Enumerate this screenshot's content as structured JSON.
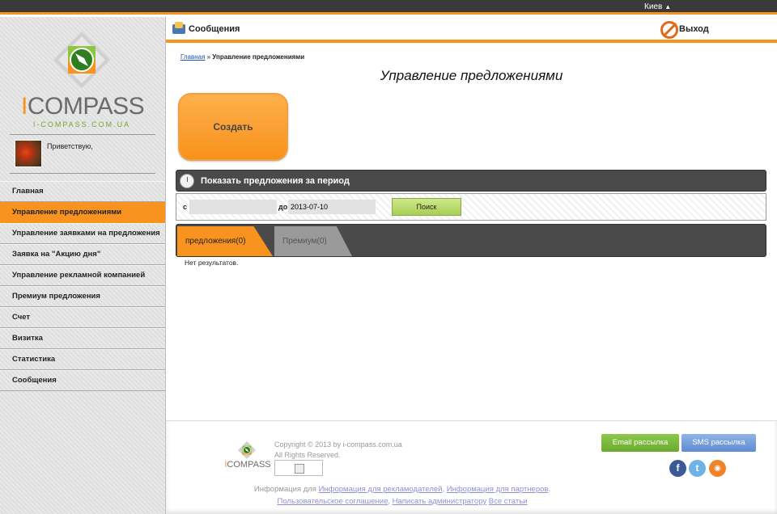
{
  "topbar": {
    "city": "Киев"
  },
  "sidebar": {
    "logo": {
      "prefix": "I",
      "word": "COMPASS",
      "url": "I-COMPASS.COM.UA"
    },
    "greeting": "Приветствую,",
    "items": [
      {
        "label": "Главная"
      },
      {
        "label": "Управление предложениями",
        "active": true
      },
      {
        "label": "Управление заявками на предложения"
      },
      {
        "label": "Заявка на \"Акцию дня\""
      },
      {
        "label": "Управление рекламной компанией"
      },
      {
        "label": "Премиум предложения"
      },
      {
        "label": "Счет"
      },
      {
        "label": "Визитка"
      },
      {
        "label": "Статистика"
      },
      {
        "label": "Сообщения"
      }
    ]
  },
  "header": {
    "messages": "Сообщения",
    "exit": "Выход"
  },
  "breadcrumb": {
    "home": "Главная",
    "sep": " » ",
    "current": "Управление предложениями"
  },
  "page_title": "Управление предложениями",
  "create_button": "Создать",
  "period_panel": {
    "title": "Показать предложения за период",
    "from_label": "с",
    "from_value": "",
    "to_label": "до",
    "to_value": "2013-07-10",
    "search_button": "Поиск"
  },
  "tabs": [
    {
      "label": "предложения(0)",
      "active": true
    },
    {
      "label": "Премиум(0)"
    }
  ],
  "no_results": "Нет результатов.",
  "footer": {
    "logo_prefix": "I",
    "logo_word": "COMPASS",
    "copyright": "Copyright © 2013 by i-compass.com.ua",
    "rights": "All Rights Reserved.",
    "email_btn": "Email рассылка",
    "sms_btn": "SMS рассылка",
    "info_prefix": "Информация для",
    "link_advertisers": "Информация для рекламодателей",
    "link_partners": "Информация для партнеров",
    "link_terms": "Пользовательское соглашение",
    "link_admin": "Написать администратору",
    "link_articles": "Все статьи"
  },
  "colors": {
    "accent": "#f7931e",
    "green": "#8cc94a",
    "blue": "#5f8cd0"
  }
}
